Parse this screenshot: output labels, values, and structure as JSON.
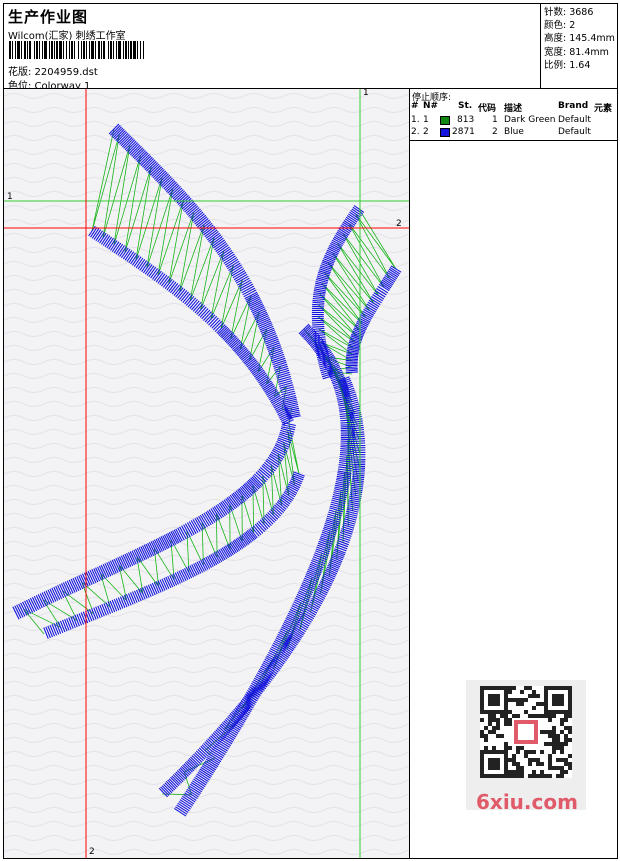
{
  "header": {
    "title": "生产作业图",
    "studio": "Wilcom(汇家) 刺绣工作室",
    "design": "花版: 2204959.dst",
    "colorway": "色位: Colorway 1"
  },
  "stats": {
    "stitches": "针数: 3686",
    "colors": "颜色: 2",
    "height": "高度: 145.4mm",
    "width": "宽度: 81.4mm",
    "scale": "比例: 1.64"
  },
  "stop_sequence": {
    "title": "停止顺序:",
    "columns": [
      "#",
      "N#",
      "St.",
      "代码",
      "描述",
      "Brand",
      "元素"
    ],
    "rows": [
      {
        "num": "1.",
        "n": "1",
        "st": "813",
        "code": "1",
        "desc": "Dark Green",
        "brand": "Default",
        "color": "#118811"
      },
      {
        "num": "2.",
        "n": "2",
        "st": "2871",
        "code": "2",
        "desc": "Blue",
        "brand": "Default",
        "color": "#1414dc"
      }
    ]
  },
  "guides": {
    "v_green_label": "1",
    "h_green_label": "1",
    "h_red_label": "2",
    "v_red_label": "2"
  },
  "watermark": {
    "text": "6xiu.com"
  }
}
